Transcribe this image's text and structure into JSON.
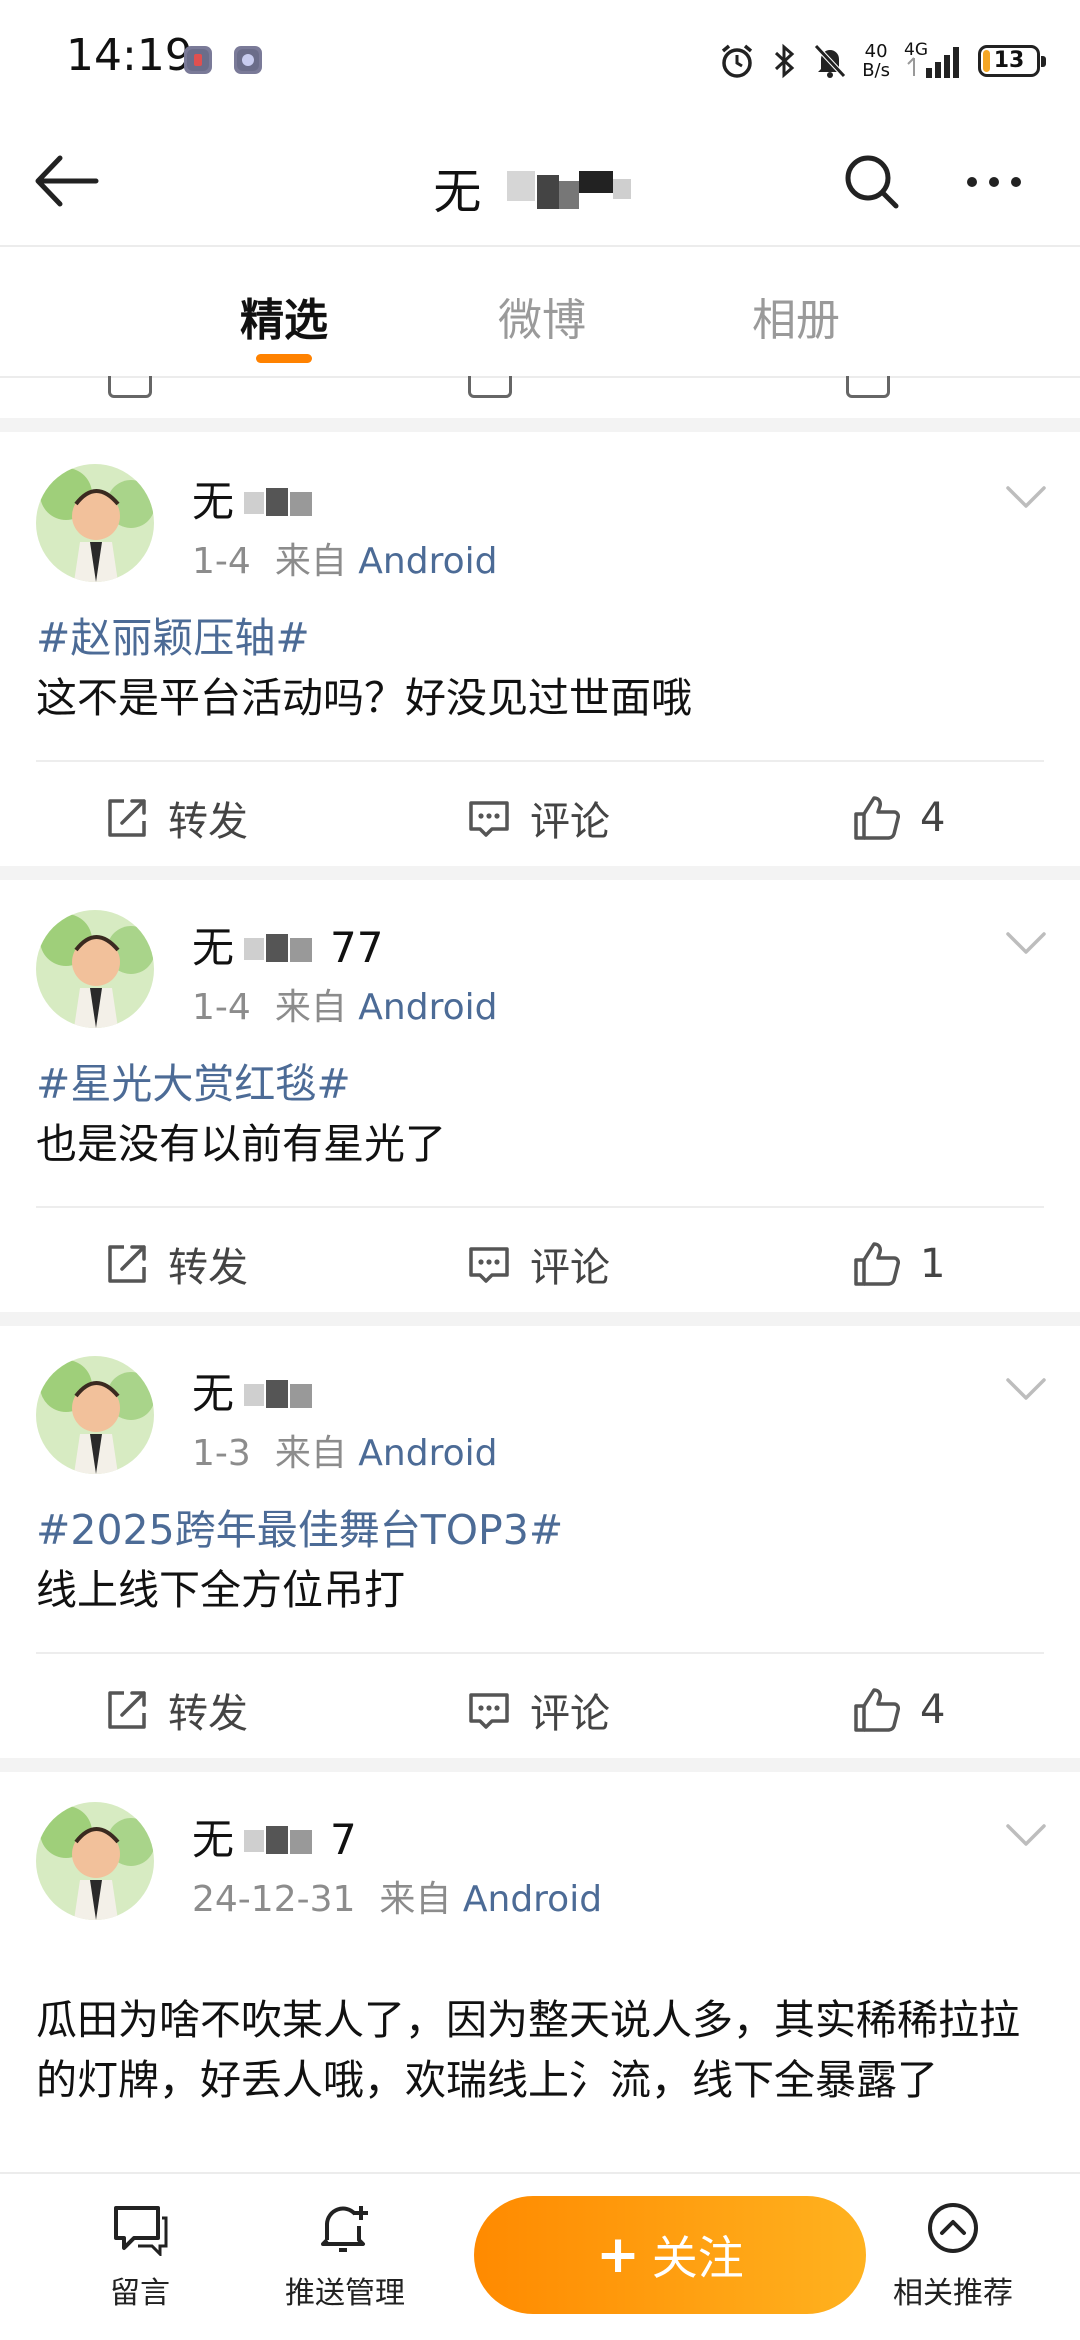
{
  "status_bar": {
    "time": "14:19",
    "net_speed_value": "40",
    "net_speed_unit": "B/s",
    "network": "4G",
    "battery": "13",
    "battery_percent": 13,
    "icons": [
      "alarm-icon",
      "bluetooth-icon",
      "mute-icon",
      "signal-icon",
      "battery-icon"
    ]
  },
  "nav": {
    "title": "无",
    "title_suffix": "",
    "icons": [
      "back-arrow-icon",
      "search-icon",
      "more-icon"
    ]
  },
  "tabs": [
    {
      "label": "精选",
      "active": true
    },
    {
      "label": "微博",
      "active": false
    },
    {
      "label": "相册",
      "active": false
    }
  ],
  "action_labels": {
    "repost": "转发",
    "comment": "评论"
  },
  "posts": [
    {
      "username": "无",
      "date": "1-4",
      "from": "来自",
      "source": "Android",
      "topic": "#赵丽颖压轴#",
      "text": "这不是平台活动吗？好没见过世面哦",
      "likes": "4"
    },
    {
      "username": "无",
      "username_suffix": "77",
      "date": "1-4",
      "from": "来自",
      "source": "Android",
      "topic": "#星光大赏红毯#",
      "text": "也是没有以前有星光了",
      "likes": "1"
    },
    {
      "username": "无",
      "date": "1-3",
      "from": "来自",
      "source": "Android",
      "topic": "#2025跨年最佳舞台TOP3#",
      "text": "线上线下全方位吊打",
      "likes": "4"
    },
    {
      "username": "无",
      "username_suffix": "7",
      "date": "24-12-31",
      "from": "来自",
      "source": "Android",
      "text": "瓜田为啥不吹某人了，因为整天说人多，其实稀稀拉拉的灯牌，好丢人哦，欢瑞线上氵流，线下全暴露了"
    }
  ],
  "bottom_bar": {
    "message": "留言",
    "push_manage": "推送管理",
    "follow_plus": "+",
    "follow": "关注",
    "related": "相关推荐"
  },
  "colors": {
    "accent": "#ff8200",
    "link": "#4c6b96",
    "follow_gradient_start": "#ff8a00",
    "follow_gradient_end": "#ffb21f"
  }
}
